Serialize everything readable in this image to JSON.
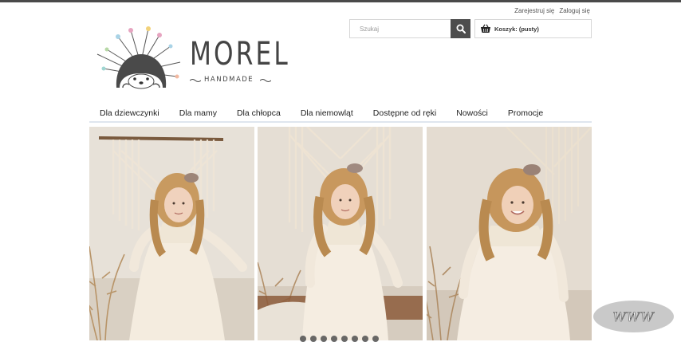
{
  "header": {
    "user_links": [
      "Zarejestruj się",
      "Zaloguj się"
    ],
    "search": {
      "placeholder": "Szukaj",
      "value": ""
    },
    "cart": {
      "label": "Koszyk: (pusty)"
    },
    "logo": {
      "word": "MOREL",
      "sub": "HANDMADE"
    }
  },
  "nav": {
    "items": [
      "Dla dziewczynki",
      "Dla mamy",
      "Dla chłopca",
      "Dla niemowląt",
      "Dostępne od ręki",
      "Nowości",
      "Promocje"
    ]
  },
  "slider": {
    "dot_count": 8
  },
  "badge": {
    "label": "WWW"
  },
  "colors": {
    "accent": "#4d4d4d",
    "nav_rule": "#dfe6ee",
    "text": "#333333"
  },
  "icons": [
    "search-icon",
    "basket-icon",
    "hedgehog-logo-icon"
  ]
}
